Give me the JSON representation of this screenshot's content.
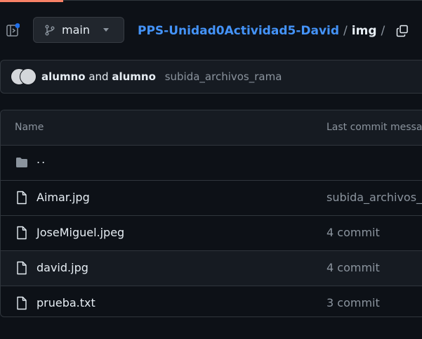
{
  "header": {
    "branch_label": "main",
    "breadcrumb": {
      "repo": "PPS-Unidad0Actividad5-David",
      "sep1": "/",
      "folder": "img",
      "sep2": "/"
    }
  },
  "commit": {
    "author1": "alumno",
    "and_text": "and",
    "author2": "alumno",
    "message": "subida_archivos_rama"
  },
  "table": {
    "col_name": "Name",
    "col_commit": "Last commit message",
    "parent": "..",
    "rows": [
      {
        "name": "Aimar.jpg",
        "commit": "subida_archivos_rama"
      },
      {
        "name": "JoseMiguel.jpeg",
        "commit": "4 commit"
      },
      {
        "name": "david.jpg",
        "commit": "4 commit"
      },
      {
        "name": "prueba.txt",
        "commit": "3 commit"
      }
    ]
  },
  "icons": {
    "sidebar": "sidebar-expand-icon",
    "branch": "git-branch-icon",
    "copy": "copy-icon",
    "folder": "folder-icon",
    "file": "file-icon"
  },
  "colors": {
    "background": "#0d1117",
    "link": "#4493f8",
    "muted": "#8b949e",
    "notification_dot": "#1f6feb",
    "progress": "#f78166"
  }
}
